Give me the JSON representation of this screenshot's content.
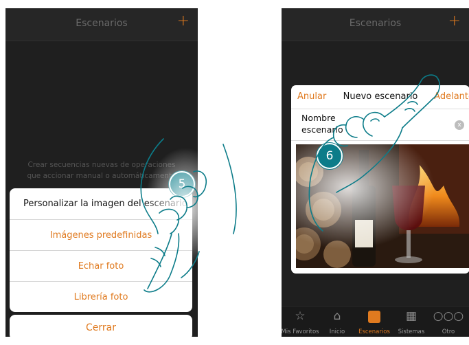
{
  "left_screen": {
    "title": "Escenarios",
    "add_icon": "+",
    "empty_text": "Crear secuencias nuevas de operaciones que accionar manual o automáticamente",
    "sheet": {
      "header": "Personalizar la imagen del escenario",
      "options": [
        "Imágenes predefinidas",
        "Echar foto",
        "Librería foto"
      ],
      "close": "Cerrar"
    },
    "step": "5"
  },
  "right_screen": {
    "title": "Escenarios",
    "add_icon": "+",
    "dialog": {
      "cancel": "Anular",
      "title": "Nuevo escenario",
      "next": "Adelante",
      "name_label": "Nombre escenario",
      "clear_icon": "x"
    },
    "step": "6",
    "tabs": [
      {
        "label": "Mis Favoritos",
        "icon": "star-icon"
      },
      {
        "label": "Inicio",
        "icon": "home-icon"
      },
      {
        "label": "Escenarios",
        "icon": "scenario-icon",
        "active": true
      },
      {
        "label": "Sistemas",
        "icon": "grid-icon"
      },
      {
        "label": "Otro",
        "icon": "more-icon"
      }
    ]
  },
  "colors": {
    "accent": "#e07a1f",
    "badge": "#0c7c89",
    "background": "#1f1f1f"
  }
}
